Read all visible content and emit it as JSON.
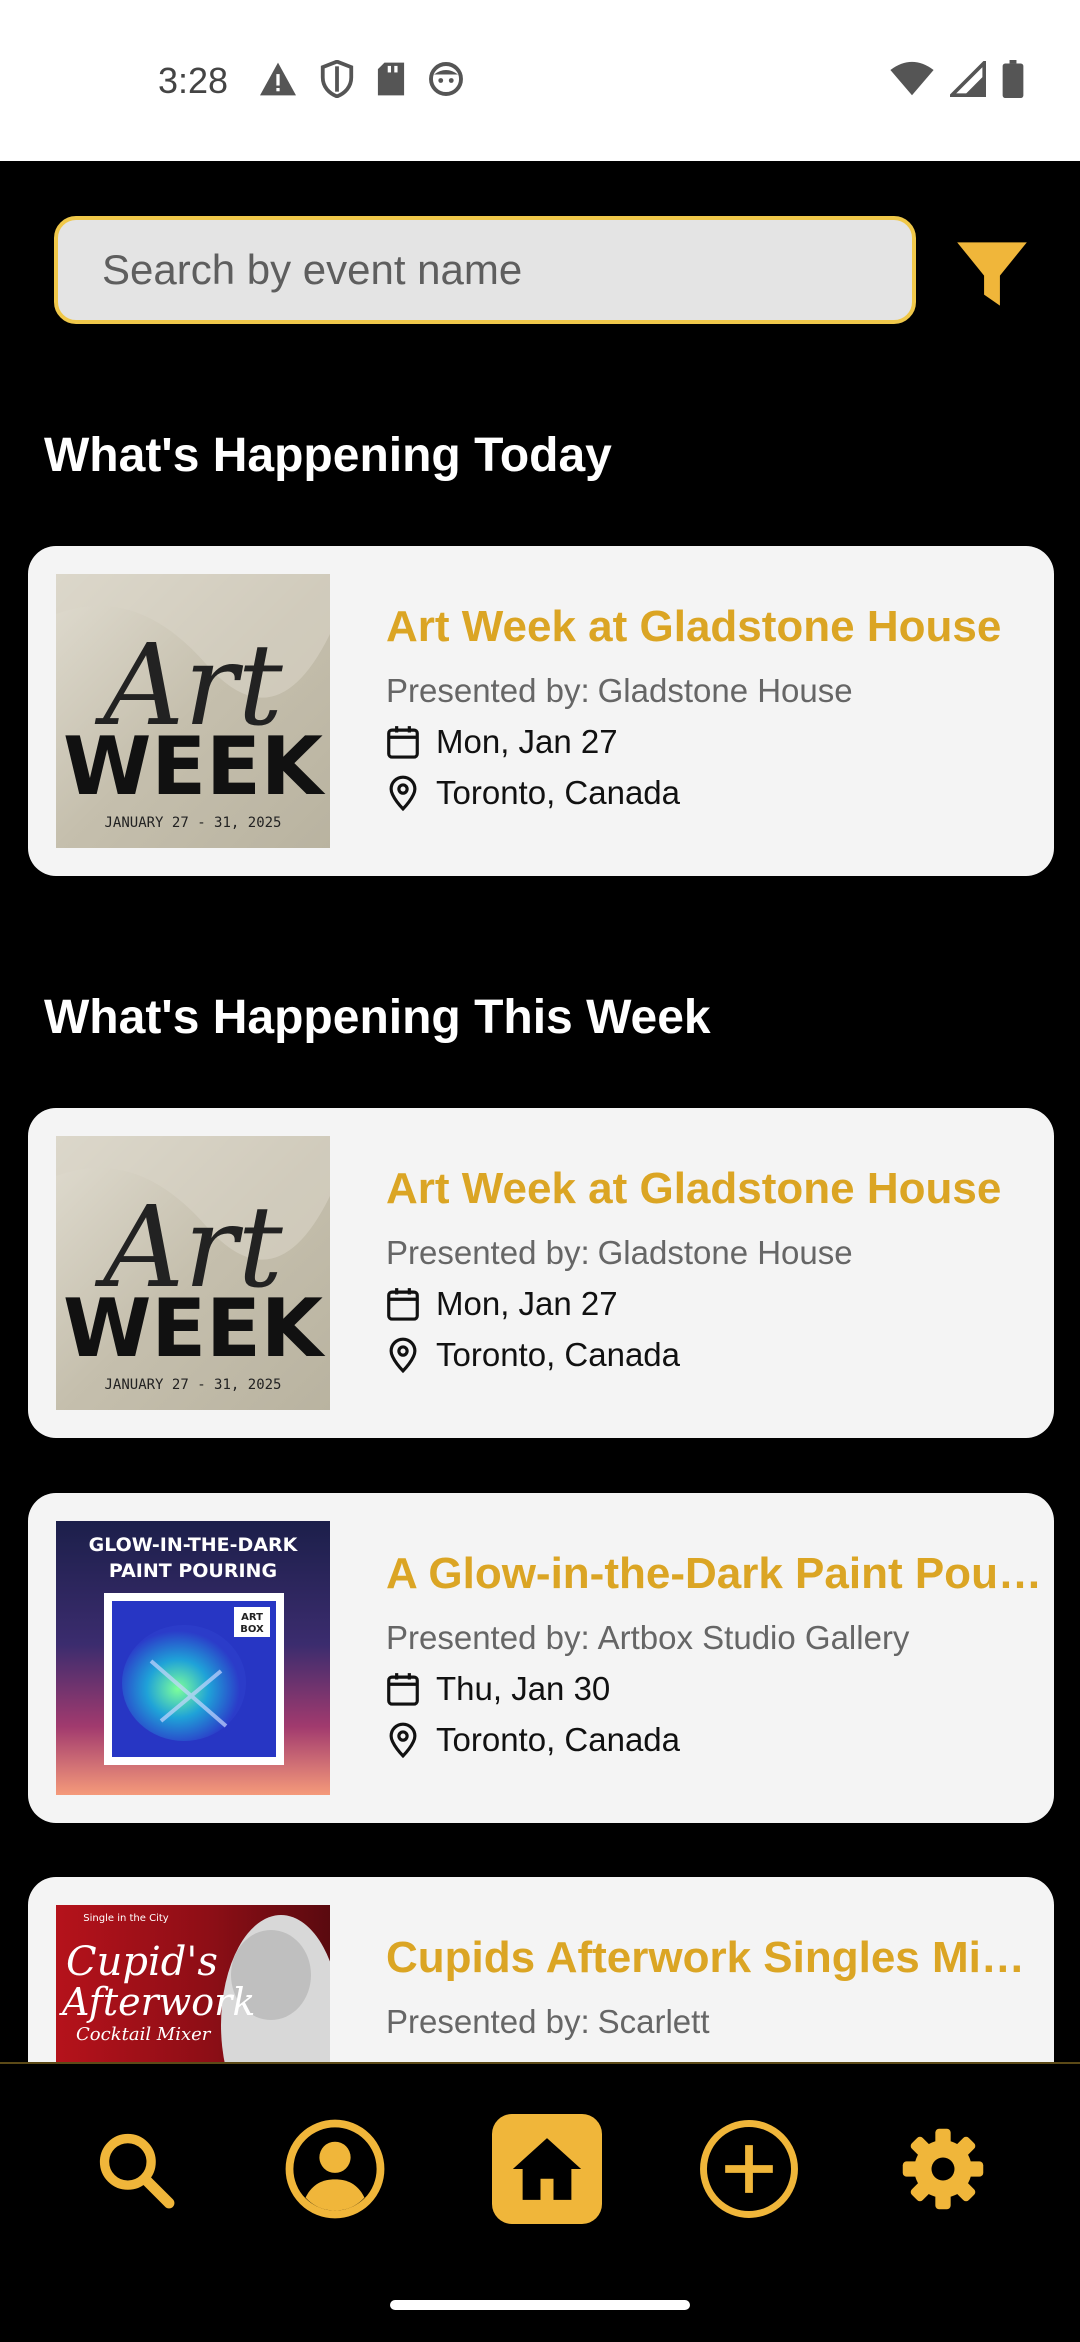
{
  "status_bar": {
    "time": "3:28"
  },
  "search": {
    "placeholder": "Search by event name"
  },
  "sections": {
    "today": "What's Happening Today",
    "this_week": "What's Happening This Week"
  },
  "presented_by_label": "Presented by:",
  "events": [
    {
      "title": "Art Week at Gladstone House",
      "presenter": "Gladstone House",
      "date": "Mon, Jan 27",
      "location": "Toronto, Canada",
      "poster": {
        "script": "Art",
        "big": "WEEK",
        "small": "JANUARY 27 - 31, 2025"
      }
    },
    {
      "title": "Art Week at Gladstone House",
      "presenter": "Gladstone House",
      "date": "Mon, Jan 27",
      "location": "Toronto, Canada",
      "poster": {
        "script": "Art",
        "big": "WEEK",
        "small": "JANUARY 27 - 31, 2025"
      }
    },
    {
      "title": "A Glow-in-the-Dark Paint Pour…",
      "presenter": "Artbox Studio Gallery",
      "date": "Thu, Jan 30",
      "location": "Toronto, Canada",
      "poster": {
        "line1": "GLOW-IN-THE-DARK",
        "line2": "PAINT POURING",
        "badge_line1": "ART",
        "badge_line2": "BOX"
      }
    },
    {
      "title": "Cupids Afterwork Singles Mix…",
      "presenter": "Scarlett",
      "poster": {
        "top": "Single in the City",
        "line1": "Cupid's",
        "line2": "Afterwork",
        "line3": "Cocktail Mixer"
      }
    }
  ],
  "colors": {
    "accent": "#f0b63a",
    "title": "#dba524",
    "card_bg": "#f4f4f4",
    "background": "#000000"
  },
  "nav": {
    "icons": [
      "search-icon",
      "profile-icon",
      "home-icon",
      "add-icon",
      "settings-icon"
    ],
    "active": "home-icon"
  }
}
